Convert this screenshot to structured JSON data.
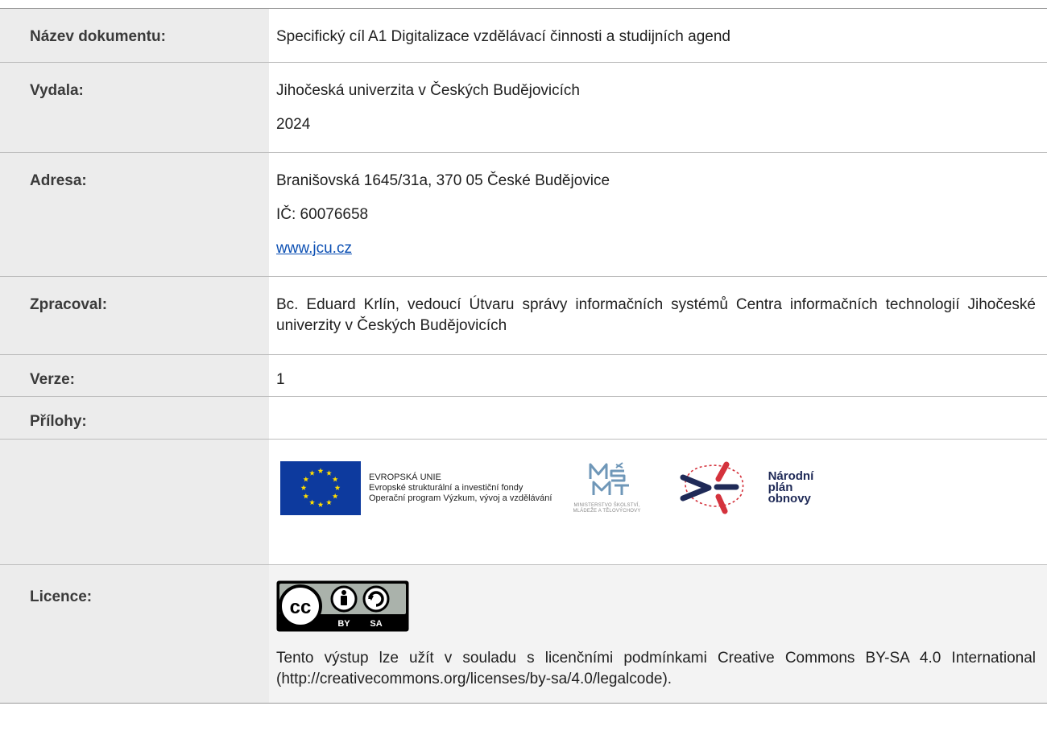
{
  "rows": {
    "nazev": {
      "label": "Název dokumentu:",
      "value": "Specifický cíl A1 Digitalizace vzdělávací činnosti a studijních agend"
    },
    "vydala": {
      "label": "Vydala:",
      "line1": "Jihočeská univerzita v Českých Budějovicích",
      "line2": "2024"
    },
    "adresa": {
      "label": "Adresa:",
      "line1": "Branišovská 1645/31a, 370 05 České Budějovice",
      "line2": "IČ: 60076658",
      "link": "www.jcu.cz"
    },
    "zpracoval": {
      "label": "Zpracoval:",
      "value": "Bc. Eduard Krlín, vedoucí Útvaru správy informačních systémů Centra informačních technologií Jihočeské univerzity v Českých Budějovicích"
    },
    "verze": {
      "label": "Verze:",
      "value": "1"
    },
    "prilohy": {
      "label": "Přílohy:",
      "value": ""
    },
    "licence": {
      "label": "Licence:",
      "text": "Tento výstup lze užít v souladu s licenčními podmínkami Creative Commons BY-SA 4.0 International (http://creativecommons.org/licenses/by-sa/4.0/legalcode)."
    }
  },
  "logos": {
    "eu_lines": [
      "EVROPSKÁ UNIE",
      "Evropské strukturální a investiční fondy",
      "Operační program Výzkum, vývoj a vzdělávání"
    ],
    "msmt_lines": [
      "MINISTERSTVO ŠKOLSTVÍ,",
      "MLÁDEŽE A TĚLOVÝCHOVY"
    ],
    "npo_lines": [
      "Národní",
      "plán",
      "obnovy"
    ],
    "cc_labels": [
      "BY",
      "SA"
    ]
  },
  "colors": {
    "label_bg": "#ececec",
    "eu_blue": "#0d3a9e",
    "eu_star": "#ffdd00",
    "npo_navy": "#1f2a57",
    "npo_red": "#d4323c",
    "link": "#0b4fb3"
  }
}
